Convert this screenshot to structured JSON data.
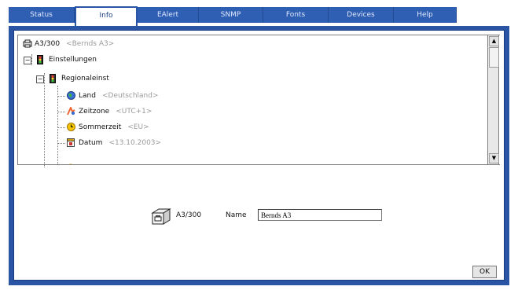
{
  "tabs": [
    {
      "label": "Status",
      "active": false
    },
    {
      "label": "Info",
      "active": true
    },
    {
      "label": "EAlert",
      "active": false
    },
    {
      "label": "SNMP",
      "active": false
    },
    {
      "label": "Fonts",
      "active": false
    },
    {
      "label": "Devices",
      "active": false
    },
    {
      "label": "Help",
      "active": false
    }
  ],
  "tree": {
    "root": {
      "label": "A3/300",
      "value": "<Bernds A3>",
      "icon": "printer-icon"
    },
    "settings": {
      "label": "Einstellungen",
      "icon": "traffic-light-icon"
    },
    "regional": {
      "label": "Regionaleinst",
      "icon": "traffic-light-icon"
    },
    "items": [
      {
        "label": "Land",
        "value": "<Deutschland>",
        "icon": "globe-icon"
      },
      {
        "label": "Zeitzone",
        "value": "<UTC+1>",
        "icon": "timezone-icon"
      },
      {
        "label": "Sommerzeit",
        "value": "<EU>",
        "icon": "sun-clock-icon"
      },
      {
        "label": "Datum",
        "value": "<13.10.2003>",
        "icon": "calendar-icon"
      }
    ]
  },
  "device": {
    "label": "A3/300",
    "icon": "printer-icon"
  },
  "name_field": {
    "label": "Name",
    "value": "Bernds A3"
  },
  "ok_label": "OK",
  "colors": {
    "tab_blue": "#2f5fb2",
    "frame_blue": "#2a55a5"
  }
}
